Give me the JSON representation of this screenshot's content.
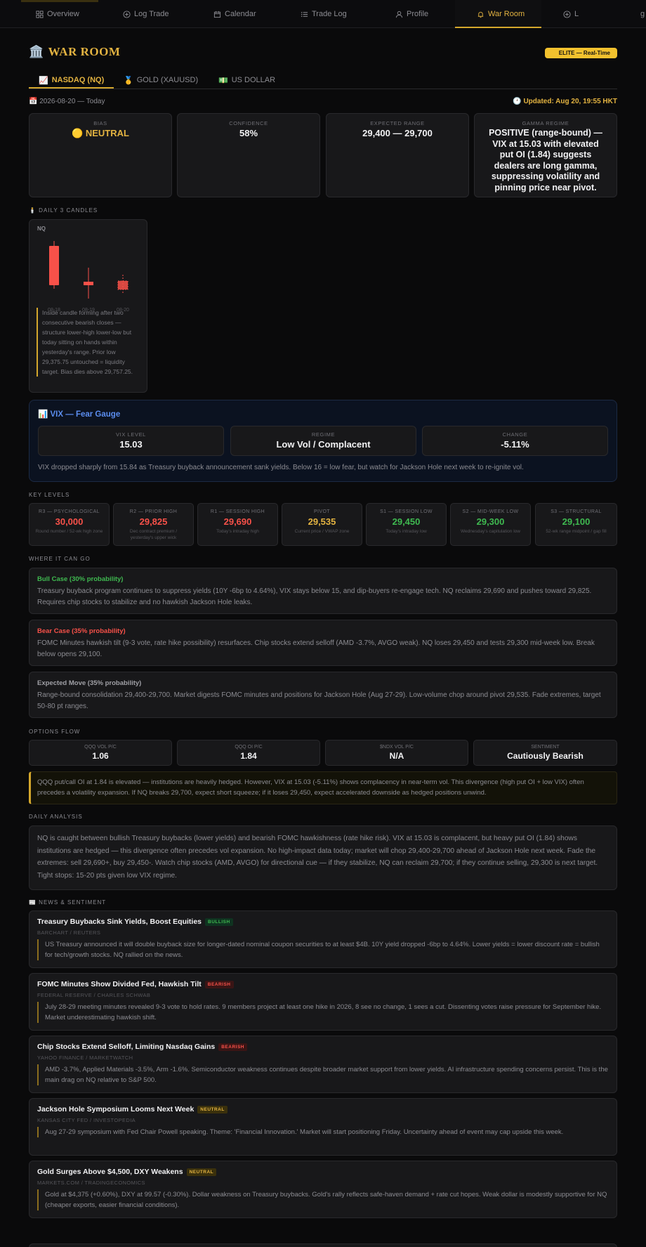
{
  "nav": {
    "items": [
      {
        "label": "Overview",
        "icon": "grid-icon"
      },
      {
        "label": "Log Trade",
        "icon": "plus-circle-icon"
      },
      {
        "label": "Calendar",
        "icon": "calendar-icon"
      },
      {
        "label": "Trade Log",
        "icon": "list-icon"
      },
      {
        "label": "Profile",
        "icon": "user-icon"
      },
      {
        "label": "War Room",
        "icon": "bell-icon"
      },
      {
        "label": "L",
        "icon": "plus-circle-icon"
      },
      {
        "label": "g",
        "icon": ""
      }
    ],
    "active": "War Room"
  },
  "header": {
    "icon": "🏛️",
    "title": "WAR ROOM",
    "badge": "ELITE — Real-Time"
  },
  "tabs": [
    {
      "icon": "📈",
      "label": "NASDAQ (NQ)"
    },
    {
      "icon": "🥇",
      "label": "GOLD (XAUUSD)"
    },
    {
      "icon": "💵",
      "label": "US DOLLAR"
    }
  ],
  "dateline": {
    "date": "📅 2026-08-20 — Today",
    "updated": "🕐 Updated: Aug 20, 19:55 HKT"
  },
  "summary": {
    "bias_label": "BIAS",
    "bias_value": "🟡 NEUTRAL",
    "confidence_label": "CONFIDENCE",
    "confidence_value": "58%",
    "range_label": "EXPECTED RANGE",
    "range_value": "29,400 — 29,700",
    "gamma_label": "GAMMA REGIME",
    "gamma_value": "POSITIVE (range-bound) — VIX at 15.03 with elevated put OI (1.84) suggests dealers are long gamma, suppressing volatility and pinning price near pivot."
  },
  "candles": {
    "section": "🕯️ DAILY 3 CANDLES",
    "symbol": "NQ",
    "dates": [
      "08-18",
      "08-19",
      "08-20"
    ],
    "note": "Inside candle forming after two consecutive bearish closes — structure lower-high lower-low but today sitting on hands within yesterday's range. Prior low 29,375.75 untouched = liquidity target. Bias dies above 29,757.25."
  },
  "vix": {
    "title": "📊 VIX — Fear Gauge",
    "level_label": "VIX LEVEL",
    "level_value": "15.03",
    "regime_label": "REGIME",
    "regime_value": "Low Vol / Complacent",
    "change_label": "CHANGE",
    "change_value": "-5.11%",
    "note": "VIX dropped sharply from 15.84 as Treasury buyback announcement sank yields. Below 16 = low fear, but watch for Jackson Hole next week to re-ignite vol."
  },
  "key_levels": {
    "section": "KEY LEVELS",
    "items": [
      {
        "title": "R3 — PSYCHOLOGICAL",
        "value": "30,000",
        "sub": "Round number / 52-wk high zone",
        "color": "#f85149"
      },
      {
        "title": "R2 — PRIOR HIGH",
        "value": "29,825",
        "sub": "Dec contract premium / yesterday's upper wick",
        "color": "#f85149"
      },
      {
        "title": "R1 — SESSION HIGH",
        "value": "29,690",
        "sub": "Today's intraday high",
        "color": "#f85149"
      },
      {
        "title": "PIVOT",
        "value": "29,535",
        "sub": "Current price / VWAP zone",
        "color": "#e3b341"
      },
      {
        "title": "S1 — SESSION LOW",
        "value": "29,450",
        "sub": "Today's intraday low",
        "color": "#3fb950"
      },
      {
        "title": "S2 — MID-WEEK LOW",
        "value": "29,300",
        "sub": "Wednesday's capitulation low",
        "color": "#3fb950"
      },
      {
        "title": "S3 — STRUCTURAL",
        "value": "29,100",
        "sub": "52-wk range midpoint / gap fill",
        "color": "#3fb950"
      }
    ]
  },
  "scenarios": {
    "section": "WHERE IT CAN GO",
    "items": [
      {
        "head": "Bull Case (30% probability)",
        "color": "#3fb950",
        "body": "Treasury buyback program continues to suppress yields (10Y -6bp to 4.64%), VIX stays below 15, and dip-buyers re-engage tech. NQ reclaims 29,690 and pushes toward 29,825. Requires chip stocks to stabilize and no hawkish Jackson Hole leaks."
      },
      {
        "head": "Bear Case (35% probability)",
        "color": "#f85149",
        "body": "FOMC Minutes hawkish tilt (9-3 vote, rate hike possibility) resurfaces. Chip stocks extend selloff (AMD -3.7%, AVGO weak). NQ loses 29,450 and tests 29,300 mid-week low. Break below opens 29,100."
      },
      {
        "head": "Expected Move (35% probability)",
        "color": "#a0a0a6",
        "body": "Range-bound consolidation 29,400-29,700. Market digests FOMC minutes and positions for Jackson Hole (Aug 27-29). Low-volume chop around pivot 29,535. Fade extremes, target 50-80 pt ranges."
      }
    ]
  },
  "options_flow": {
    "section": "OPTIONS FLOW",
    "items": [
      {
        "label": "QQQ VOL P/C",
        "value": "1.06"
      },
      {
        "label": "QQQ OI P/C",
        "value": "1.84"
      },
      {
        "label": "$NDX VOL P/C",
        "value": "N/A"
      },
      {
        "label": "SENTIMENT",
        "value": "Cautiously Bearish"
      }
    ],
    "note": "QQQ put/call OI at 1.84 is elevated — institutions are heavily hedged. However, VIX at 15.03 (-5.11%) shows complacency in near-term vol. This divergence (high put OI + low VIX) often precedes a volatility expansion. If NQ breaks 29,700, expect short squeeze; if it loses 29,450, expect accelerated downside as hedged positions unwind."
  },
  "analysis": {
    "section": "DAILY ANALYSIS",
    "body": "NQ is caught between bullish Treasury buybacks (lower yields) and bearish FOMC hawkishness (rate hike risk). VIX at 15.03 is complacent, but heavy put OI (1.84) shows institutions are hedged — this divergence often precedes vol expansion. No high-impact data today; market will chop 29,400-29,700 ahead of Jackson Hole next week. Fade the extremes: sell 29,690+, buy 29,450-. Watch chip stocks (AMD, AVGO) for directional cue — if they stabilize, NQ can reclaim 29,700; if they continue selling, 29,300 is next target. Tight stops: 15-20 pts given low VIX regime."
  },
  "news": {
    "section": "📰 NEWS & SENTIMENT",
    "items": [
      {
        "head": "Treasury Buybacks Sink Yields, Boost Equities",
        "badge": "BULLISH",
        "source": "BARCHART / REUTERS",
        "body": "US Treasury announced it will double buyback size for longer-dated nominal coupon securities to at least $4B. 10Y yield dropped -6bp to 4.64%. Lower yields = lower discount rate = bullish for tech/growth stocks. NQ rallied on the news."
      },
      {
        "head": "FOMC Minutes Show Divided Fed, Hawkish Tilt",
        "badge": "BEARISH",
        "source": "FEDERAL RESERVE / CHARLES SCHWAB",
        "body": "July 28-29 meeting minutes revealed 9-3 vote to hold rates. 9 members project at least one hike in 2026, 8 see no change, 1 sees a cut. Dissenting votes raise pressure for September hike. Market underestimating hawkish shift."
      },
      {
        "head": "Chip Stocks Extend Selloff, Limiting Nasdaq Gains",
        "badge": "BEARISH",
        "source": "YAHOO FINANCE / MARKETWATCH",
        "body": "AMD -3.7%, Applied Materials -3.5%, Arm -1.6%. Semiconductor weakness continues despite broader market support from lower yields. AI infrastructure spending concerns persist. This is the main drag on NQ relative to S&P 500."
      },
      {
        "head": "Jackson Hole Symposium Looms Next Week",
        "badge": "NEUTRAL",
        "source": "KANSAS CITY FED / INVESTOPEDIA",
        "body": "Aug 27-29 symposium with Fed Chair Powell speaking. Theme: 'Financial Innovation.' Market will start positioning Friday. Uncertainty ahead of event may cap upside this week."
      },
      {
        "head": "Gold Surges Above $4,500, DXY Weakens",
        "badge": "NEUTRAL",
        "source": "MARKETS.COM / TRADINGECONOMICS",
        "body": "Gold at $4,375 (+0.60%), DXY at 99.57 (-0.30%). Dollar weakness on Treasury buybacks. Gold's rally reflects safe-haven demand + rate cut hopes. Weak dollar is modestly supportive for NQ (cheaper exports, easier financial conditions)."
      }
    ]
  }
}
